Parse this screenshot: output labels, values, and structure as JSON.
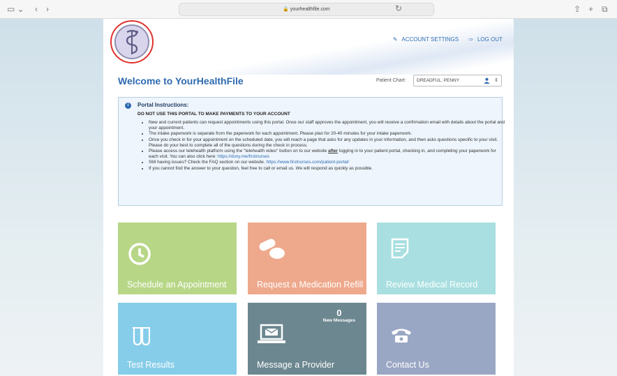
{
  "browser": {
    "url": "yourhealthfile.com"
  },
  "header": {
    "account_settings": "ACCOUNT SETTINGS",
    "log_out": "LOG OUT"
  },
  "welcome": {
    "title": "Welcome to YourHealthFile",
    "chart_label": "Patient Chart:",
    "chart_value": "DREADFUL, PENNY"
  },
  "instructions": {
    "title": "Portal Instructions:",
    "warning": "DO NOT USE THIS PORTAL TO MAKE PAYMENTS TO YOUR ACCOUNT",
    "item1": "New and current patients can request appointments using this portal. Once our staff approves the appointment, you will receive a confirmation email with details about the portal and your appointment.",
    "item2": "The intake paperwork is separate from the paperwork for each appointment. Please plan for 20-40 minutes for your intake paperwork.",
    "item3": "Once you check in for your appointment on the scheduled date, you will reach a page that asks for any updates in your information, and then asks questions specific to your visit. Please do your best to complete all of the questions during the check in process.",
    "item4_a": "Please access our telehealth platform using the \"telehealth video\" button on to our website ",
    "item4_b": "after",
    "item4_c": " logging in to your patient portal, checking in, and completing your paperwork for each visit. You can also click here: ",
    "item4_link": "https://doxy.me/firstnurses",
    "item5_a": "Still having issues? Check the FAQ section on our website. ",
    "item5_link": "https://www.firstnurses.com/patient-portal/",
    "item6": "If you cannot find the answer to your question, feel free to call or email us. We will respond as quickly as possible."
  },
  "tiles": {
    "schedule": "Schedule an Appointment",
    "refill": "Request a Medication Refill",
    "record": "Review Medical Record",
    "tests": "Test Results",
    "message": "Message a Provider",
    "messages_count": "0",
    "messages_label": "New Messages",
    "contact": "Contact Us"
  },
  "colors": {
    "brand_blue": "#2e6ab0",
    "schedule": "#b7d787",
    "refill": "#eea98d",
    "record": "#a9dfe0",
    "tests": "#86cde9",
    "message": "#6c8790",
    "contact": "#9aa7c4"
  }
}
